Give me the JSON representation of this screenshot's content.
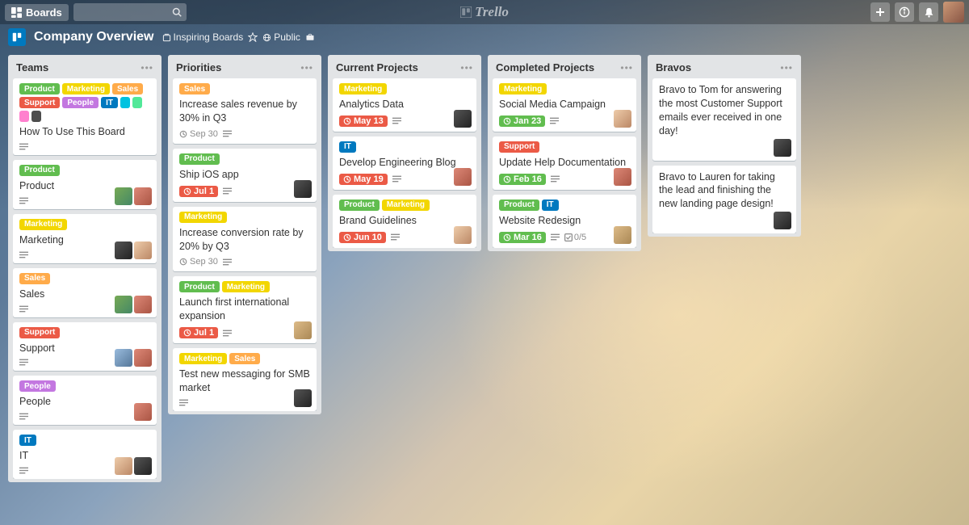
{
  "top": {
    "boards_label": "Boards",
    "logo_text": "Trello"
  },
  "board": {
    "title": "Company Overview",
    "inspiring": "Inspiring Boards",
    "visibility": "Public"
  },
  "labelColors": {
    "Product": "green",
    "Marketing": "yellow",
    "Sales": "orange",
    "Support": "red",
    "People": "purple",
    "IT": "blue"
  },
  "lists": [
    {
      "title": "Teams",
      "cards": [
        {
          "labels": [
            [
              "Product",
              "green"
            ],
            [
              "Marketing",
              "yellow"
            ],
            [
              "Sales",
              "orange"
            ],
            [
              "Support",
              "red"
            ],
            [
              "People",
              "purple"
            ],
            [
              "IT",
              "blue"
            ],
            [
              "",
              "sky"
            ],
            [
              "",
              "lime"
            ],
            [
              "",
              "pink"
            ],
            [
              "",
              "dark"
            ]
          ],
          "title": "How To Use This Board",
          "desc": true
        },
        {
          "labels": [
            [
              "Product",
              "green"
            ]
          ],
          "title": "Product",
          "desc": true,
          "members": [
            "m1",
            "m2"
          ]
        },
        {
          "labels": [
            [
              "Marketing",
              "yellow"
            ]
          ],
          "title": "Marketing",
          "desc": true,
          "members": [
            "m3",
            "m4"
          ]
        },
        {
          "labels": [
            [
              "Sales",
              "orange"
            ]
          ],
          "title": "Sales",
          "desc": true,
          "members": [
            "m1",
            "m2"
          ]
        },
        {
          "labels": [
            [
              "Support",
              "red"
            ]
          ],
          "title": "Support",
          "desc": true,
          "members": [
            "m5",
            "m2"
          ]
        },
        {
          "labels": [
            [
              "People",
              "purple"
            ]
          ],
          "title": "People",
          "desc": true,
          "members": [
            "m2"
          ]
        },
        {
          "labels": [
            [
              "IT",
              "blue"
            ]
          ],
          "title": "IT",
          "desc": true,
          "members": [
            "m4",
            "m3"
          ]
        }
      ]
    },
    {
      "title": "Priorities",
      "cards": [
        {
          "labels": [
            [
              "Sales",
              "orange"
            ]
          ],
          "title": "Increase sales revenue by 30% in Q3",
          "date": "Sep 30",
          "dateStyle": "plain",
          "desc": true
        },
        {
          "labels": [
            [
              "Product",
              "green"
            ]
          ],
          "title": "Ship iOS app",
          "due": "Jul 1",
          "desc": true,
          "members": [
            "m3"
          ]
        },
        {
          "labels": [
            [
              "Marketing",
              "yellow"
            ]
          ],
          "title": "Increase conversion rate by 20% by Q3",
          "date": "Sep 30",
          "dateStyle": "plain",
          "desc": true
        },
        {
          "labels": [
            [
              "Product",
              "green"
            ],
            [
              "Marketing",
              "yellow"
            ]
          ],
          "title": "Launch first international expansion",
          "due": "Jul 1",
          "desc": true,
          "members": [
            "m6"
          ]
        },
        {
          "labels": [
            [
              "Marketing",
              "yellow"
            ],
            [
              "Sales",
              "orange"
            ]
          ],
          "title": "Test new messaging for SMB market",
          "desc": true,
          "members": [
            "m3"
          ]
        }
      ]
    },
    {
      "title": "Current Projects",
      "cards": [
        {
          "labels": [
            [
              "Marketing",
              "yellow"
            ]
          ],
          "title": "Analytics Data",
          "due": "May 13",
          "desc": true,
          "members": [
            "m3"
          ]
        },
        {
          "labels": [
            [
              "IT",
              "blue"
            ]
          ],
          "title": "Develop Engineering Blog",
          "due": "May 19",
          "desc": true,
          "members": [
            "m2"
          ]
        },
        {
          "labels": [
            [
              "Product",
              "green"
            ],
            [
              "Marketing",
              "yellow"
            ]
          ],
          "title": "Brand Guidelines",
          "due": "Jun 10",
          "desc": true,
          "members": [
            "m4"
          ]
        }
      ]
    },
    {
      "title": "Completed Projects",
      "cards": [
        {
          "labels": [
            [
              "Marketing",
              "yellow"
            ]
          ],
          "title": "Social Media Campaign",
          "due": "Jan 23",
          "dueColor": "green",
          "desc": true,
          "members": [
            "m4"
          ]
        },
        {
          "labels": [
            [
              "Support",
              "red"
            ]
          ],
          "title": "Update Help Documentation",
          "due": "Feb 16",
          "dueColor": "green",
          "desc": true,
          "members": [
            "m2"
          ]
        },
        {
          "labels": [
            [
              "Product",
              "green"
            ],
            [
              "IT",
              "blue"
            ]
          ],
          "title": "Website Redesign",
          "due": "Mar 16",
          "dueColor": "green",
          "desc": true,
          "checklist": "0/5",
          "members": [
            "m6"
          ]
        }
      ]
    },
    {
      "title": "Bravos",
      "cards": [
        {
          "title": "Bravo to Tom for answering the most Customer Support emails ever received in one day!",
          "members": [
            "m3"
          ]
        },
        {
          "title": "Bravo to Lauren for taking the lead and finishing the new landing page design!",
          "members": [
            "m3"
          ]
        }
      ]
    }
  ]
}
